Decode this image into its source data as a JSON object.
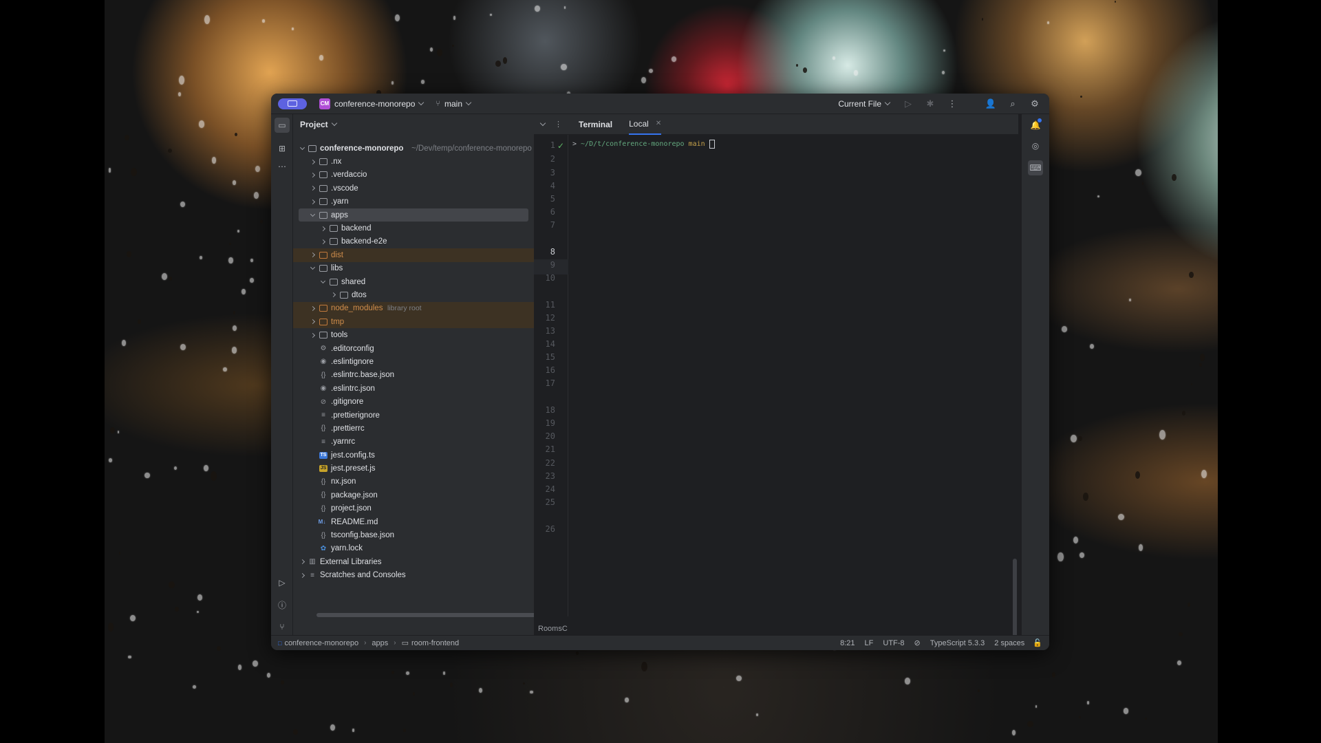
{
  "titlebar": {
    "project_badge": "CM",
    "project_name": "conference-monorepo",
    "branch": "main",
    "run_config": "Current File"
  },
  "project_panel": {
    "title": "Project",
    "root": {
      "name": "conference-monorepo",
      "path": "~/Dev/temp/conference-monorepo"
    },
    "items": [
      {
        "label": ".nx"
      },
      {
        "label": ".verdaccio"
      },
      {
        "label": ".vscode"
      },
      {
        "label": ".yarn"
      },
      {
        "label": "apps"
      },
      {
        "label": "backend"
      },
      {
        "label": "backend-e2e"
      },
      {
        "label": "dist"
      },
      {
        "label": "libs"
      },
      {
        "label": "shared"
      },
      {
        "label": "dtos"
      },
      {
        "label": "node_modules",
        "hint": "library root"
      },
      {
        "label": "tmp"
      },
      {
        "label": "tools"
      },
      {
        "label": ".editorconfig"
      },
      {
        "label": ".eslintignore"
      },
      {
        "label": ".eslintrc.base.json"
      },
      {
        "label": ".eslintrc.json"
      },
      {
        "label": ".gitignore"
      },
      {
        "label": ".prettierignore"
      },
      {
        "label": ".prettierrc"
      },
      {
        "label": ".yarnrc"
      },
      {
        "label": "jest.config.ts",
        "badge": "TS"
      },
      {
        "label": "jest.preset.js",
        "badge": "JS"
      },
      {
        "label": "nx.json"
      },
      {
        "label": "package.json"
      },
      {
        "label": "project.json"
      },
      {
        "label": "README.md",
        "badge": "M↓"
      },
      {
        "label": "tsconfig.base.json"
      },
      {
        "label": "yarn.lock"
      },
      {
        "label": "External Libraries"
      },
      {
        "label": "Scratches and Consoles"
      }
    ]
  },
  "editor": {
    "tab_title": "Terminal",
    "tab_local": "Local",
    "prompt": ">",
    "path": "~/D/t/conference-monorepo",
    "branch": "main",
    "line_numbers": [
      "1",
      "2",
      "3",
      "4",
      "5",
      "6",
      "7",
      "8",
      "9",
      "10",
      "11",
      "12",
      "13",
      "14",
      "15",
      "16",
      "17",
      "18",
      "19",
      "20",
      "21",
      "22",
      "23",
      "24",
      "25",
      "26"
    ],
    "current_line": "8",
    "bottom_label": "RoomsC"
  },
  "status": {
    "crumbs": [
      "conference-monorepo",
      "apps",
      "room-frontend"
    ],
    "position": "8:21",
    "line_sep": "LF",
    "encoding": "UTF-8",
    "language": "TypeScript 5.3.3",
    "indent": "2 spaces"
  },
  "colors": {
    "accent": "#3574f0",
    "window_bg": "#1e1f22",
    "panel_bg": "#2b2d30",
    "excluded_bg": "#3d3223",
    "excluded_text": "#d08d4b"
  }
}
